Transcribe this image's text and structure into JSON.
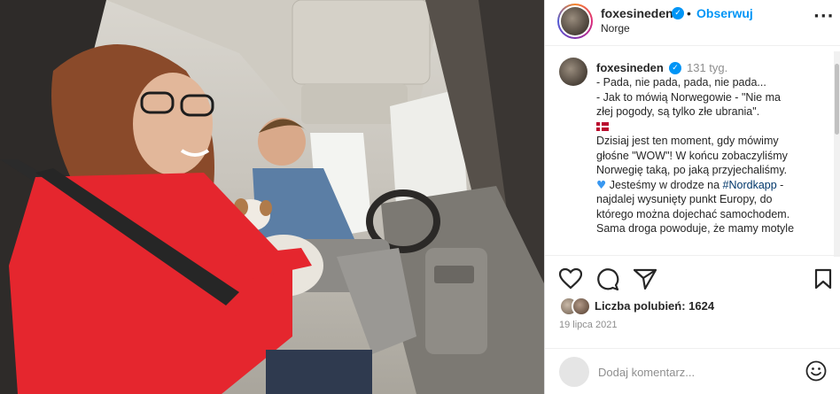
{
  "post": {
    "username": "foxesineden",
    "follow_separator": "•",
    "follow_label": "Obserwuj",
    "location": "Norge",
    "more_label": "···"
  },
  "caption": {
    "username": "foxesineden",
    "time_ago": "131 tyg.",
    "lines": [
      "- Pada, nie pada, pada, nie pada...",
      "- Jak to mówią Norwegowie - \"Nie ma",
      "złej pogody, są tylko złe ubrania\".",
      "Dzisiaj jest ten moment, gdy mówimy",
      "głośne \"WOW\"! W końcu zobaczyliśmy",
      "Norwegię taką, po jaką przyjechaliśmy.",
      "Jesteśmy w drodze na",
      "#Nordkapp",
      " -",
      "najdalej wysunięty punkt Europy, do",
      "którego można dojechać samochodem.",
      "Sama droga powoduje, że mamy motyle"
    ]
  },
  "actions": {
    "like_icon": "heart-outline-icon",
    "comment_icon": "comment-bubble-icon",
    "share_icon": "paper-plane-icon",
    "save_icon": "bookmark-icon"
  },
  "likes": {
    "label": "Liczba polubień: 1624"
  },
  "date": "19 lipca 2021",
  "comment": {
    "placeholder": "Dodaj komentarz..."
  },
  "colors": {
    "accent": "#0095f6",
    "hashtag": "#00376b",
    "muted": "#8e8e8e",
    "text": "#262626"
  }
}
